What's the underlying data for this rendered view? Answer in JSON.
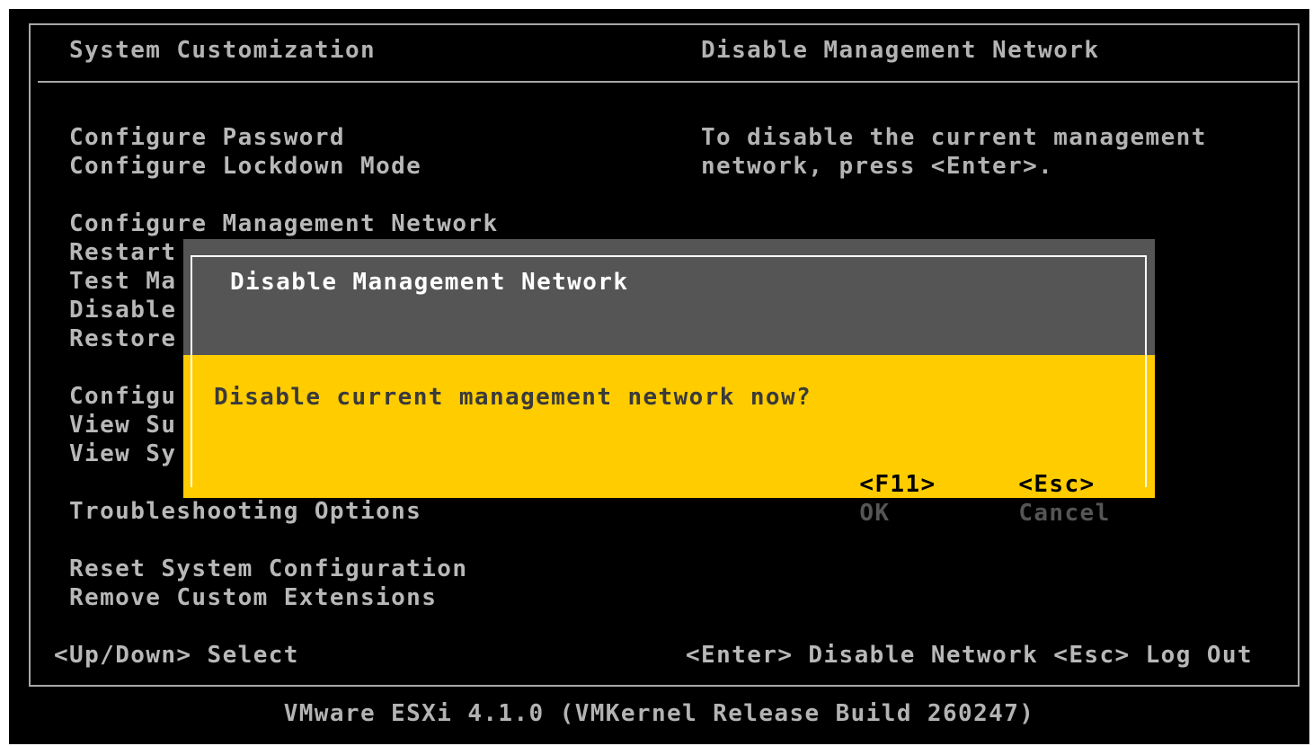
{
  "header": {
    "left_title": "System Customization",
    "right_title": "Disable Management Network"
  },
  "menu": {
    "group1": [
      "Configure Password",
      "Configure Lockdown Mode"
    ],
    "group2": [
      "Configure Management Network",
      "Restart",
      "Test Ma",
      "Disable",
      "Restore"
    ],
    "group3": [
      "Configu",
      "View Su",
      "View Sy"
    ],
    "group4": [
      "Troubleshooting Options"
    ],
    "group5": [
      "Reset System Configuration",
      "Remove Custom Extensions"
    ]
  },
  "description": {
    "line1": "To disable the current management",
    "line2": "network, press <Enter>."
  },
  "dialog": {
    "title": "Disable Management Network",
    "question": "Disable current management network now?",
    "ok_key": "<F11>",
    "ok_label": "OK",
    "cancel_key": "<Esc>",
    "cancel_label": "Cancel"
  },
  "footer": {
    "left_hint": "<Up/Down> Select",
    "right_hint": "<Enter> Disable Network <Esc> Log Out",
    "version": "VMware ESXi 4.1.0 (VMKernel Release Build 260247)"
  },
  "colors": {
    "background": "#000000",
    "text": "#b3b3b3",
    "dialog_header": "#555555",
    "dialog_body": "#ffcc00"
  }
}
